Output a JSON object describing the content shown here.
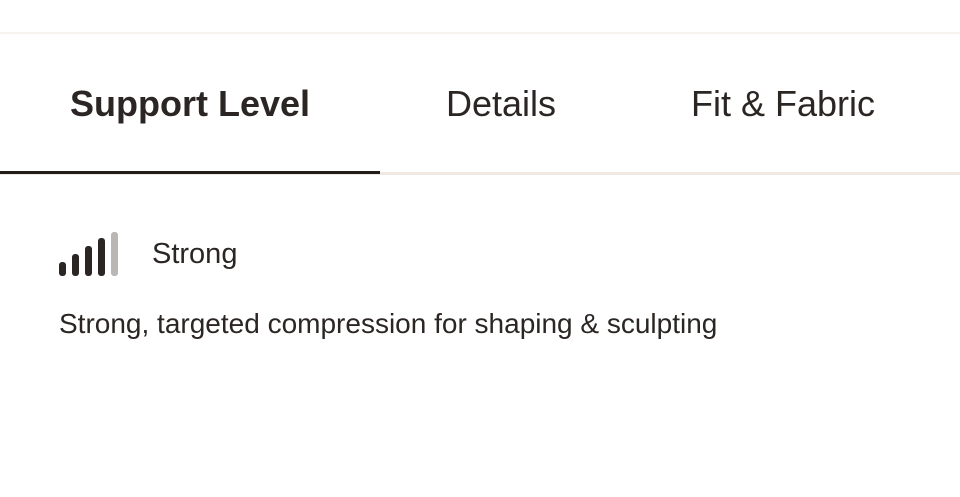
{
  "tabs": [
    {
      "label": "Support Level",
      "active": true
    },
    {
      "label": "Details",
      "active": false
    },
    {
      "label": "Fit & Fabric",
      "active": false
    }
  ],
  "support": {
    "level_label": "Strong",
    "level_filled": 4,
    "level_total": 5,
    "description": "Strong, targeted compression for shaping & sculpting"
  },
  "colors": {
    "text": "#2b2623",
    "bar_filled": "#2b2623",
    "bar_empty": "#b9b6b3",
    "tab_indicator": "#221c18",
    "tab_track": "#efe8e3"
  },
  "icons": {
    "support_level": "signal-bars-icon"
  }
}
